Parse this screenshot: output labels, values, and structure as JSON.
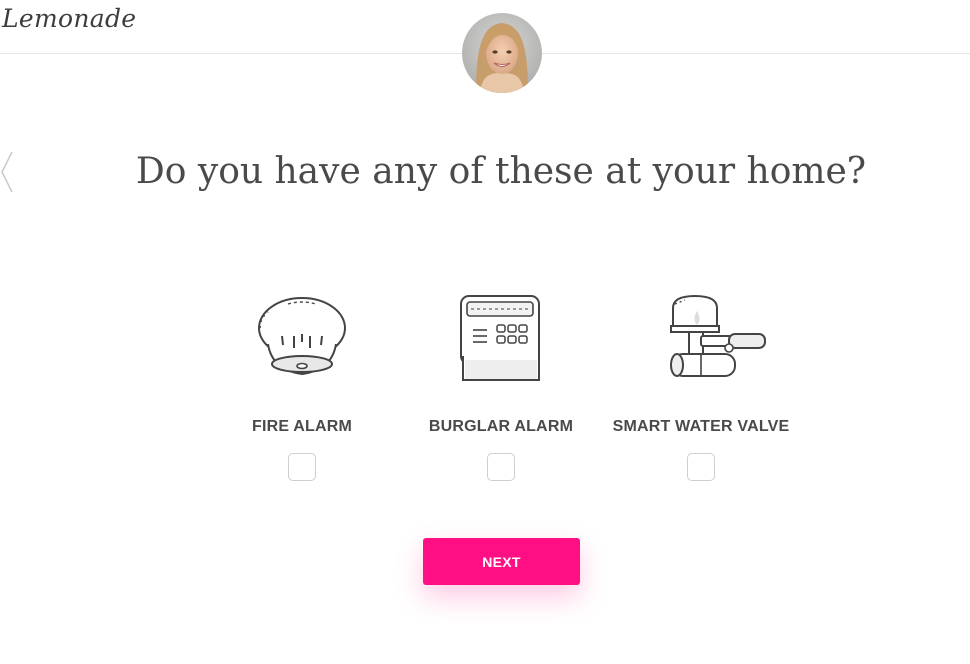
{
  "header": {
    "logo_text": "Lemonade"
  },
  "question": "Do you have any of these at your home?",
  "options": [
    {
      "label": "FIRE ALARM",
      "checked": false,
      "icon": "fire-alarm-icon"
    },
    {
      "label": "BURGLAR ALARM",
      "checked": false,
      "icon": "burglar-alarm-icon"
    },
    {
      "label": "SMART WATER VALVE",
      "checked": false,
      "icon": "smart-water-valve-icon"
    }
  ],
  "next_button": {
    "label": "NEXT"
  },
  "colors": {
    "accent": "#ff0f83",
    "text": "#4a4a4a",
    "divider": "#e6e6e6"
  }
}
